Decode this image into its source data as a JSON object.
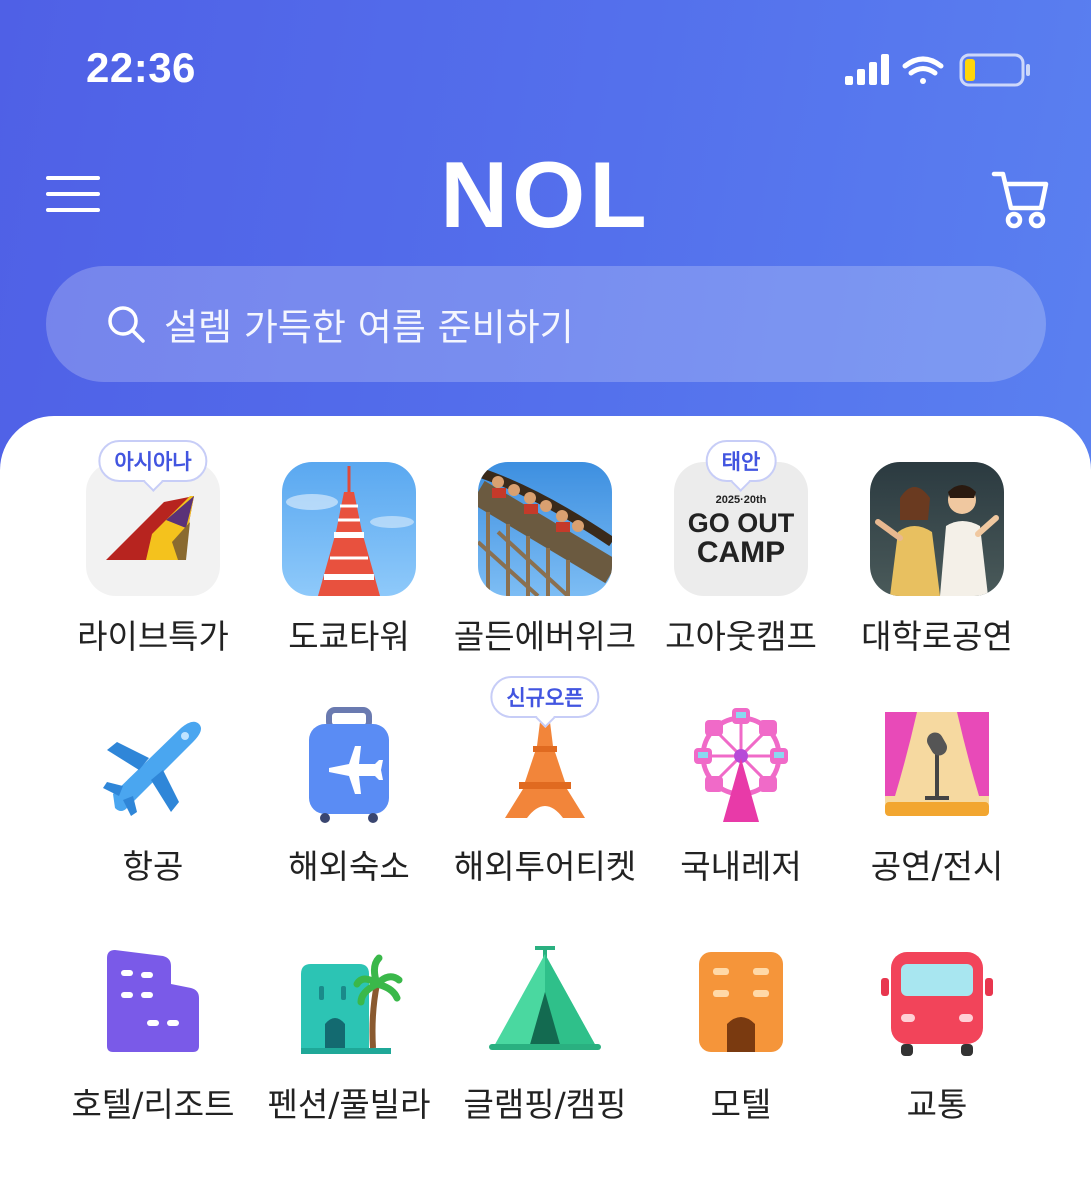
{
  "status_bar": {
    "time": "22:36"
  },
  "header": {
    "logo": "NOL",
    "search_placeholder": "설렘 가득한 여름 준비하기"
  },
  "categories_row1": [
    {
      "label": "라이브특가",
      "badge": "아시아나",
      "icon": "asiana-logo-icon"
    },
    {
      "label": "도쿄타워",
      "badge": "",
      "icon": "tokyo-tower-photo"
    },
    {
      "label": "골든에버위크",
      "badge": "",
      "icon": "rollercoaster-photo"
    },
    {
      "label": "고아웃캠프",
      "badge": "태안",
      "icon": "goout-camp-logo",
      "tile_text": {
        "year": "2025·20th",
        "line1": "GO OUT",
        "line2": "CAMP"
      }
    },
    {
      "label": "대학로공연",
      "badge": "",
      "icon": "musical-photo"
    }
  ],
  "categories_row2": [
    {
      "label": "항공",
      "icon": "airplane-icon"
    },
    {
      "label": "해외숙소",
      "icon": "suitcase-icon"
    },
    {
      "label": "해외투어티켓",
      "badge": "신규오픈",
      "icon": "eiffel-tower-icon"
    },
    {
      "label": "국내레저",
      "icon": "ferris-wheel-icon"
    },
    {
      "label": "공연/전시",
      "icon": "stage-microphone-icon"
    }
  ],
  "categories_row3": [
    {
      "label": "호텔/리조트",
      "icon": "hotel-icon"
    },
    {
      "label": "펜션/풀빌라",
      "icon": "pool-villa-icon"
    },
    {
      "label": "글램핑/캠핑",
      "icon": "tent-icon"
    },
    {
      "label": "모텔",
      "icon": "motel-icon"
    },
    {
      "label": "교통",
      "icon": "bus-icon"
    }
  ]
}
